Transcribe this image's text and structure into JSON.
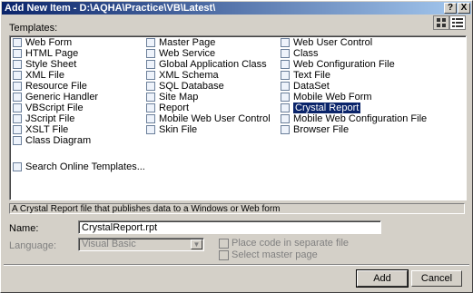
{
  "window": {
    "title": "Add New Item - D:\\AQHA\\Practice\\VB\\Latest\\",
    "help_button": "?",
    "close_button": "X"
  },
  "templates_label": "Templates:",
  "templates": {
    "col1": [
      "Web Form",
      "HTML Page",
      "Style Sheet",
      "XML File",
      "Resource File",
      "Generic Handler",
      "VBScript File",
      "JScript File",
      "XSLT File",
      "Class Diagram"
    ],
    "col2": [
      "Master Page",
      "Web Service",
      "Global Application Class",
      "XML Schema",
      "SQL Database",
      "Site Map",
      "Report",
      "Mobile Web User Control",
      "Skin File"
    ],
    "col3": [
      "Web User Control",
      "Class",
      "Web Configuration File",
      "Text File",
      "DataSet",
      "Mobile Web Form",
      "Crystal Report",
      "Mobile Web Configuration File",
      "Browser File"
    ],
    "selected": "Crystal Report",
    "search_online": "Search Online Templates..."
  },
  "description": "A Crystal Report file that publishes data to a Windows or Web form",
  "name_label": "Name:",
  "name_value": "CrystalReport.rpt",
  "language_label": "Language:",
  "language_value": "Visual Basic",
  "place_code_label": "Place code in separate file",
  "select_master_label": "Select master page",
  "add_button": "Add",
  "cancel_button": "Cancel"
}
